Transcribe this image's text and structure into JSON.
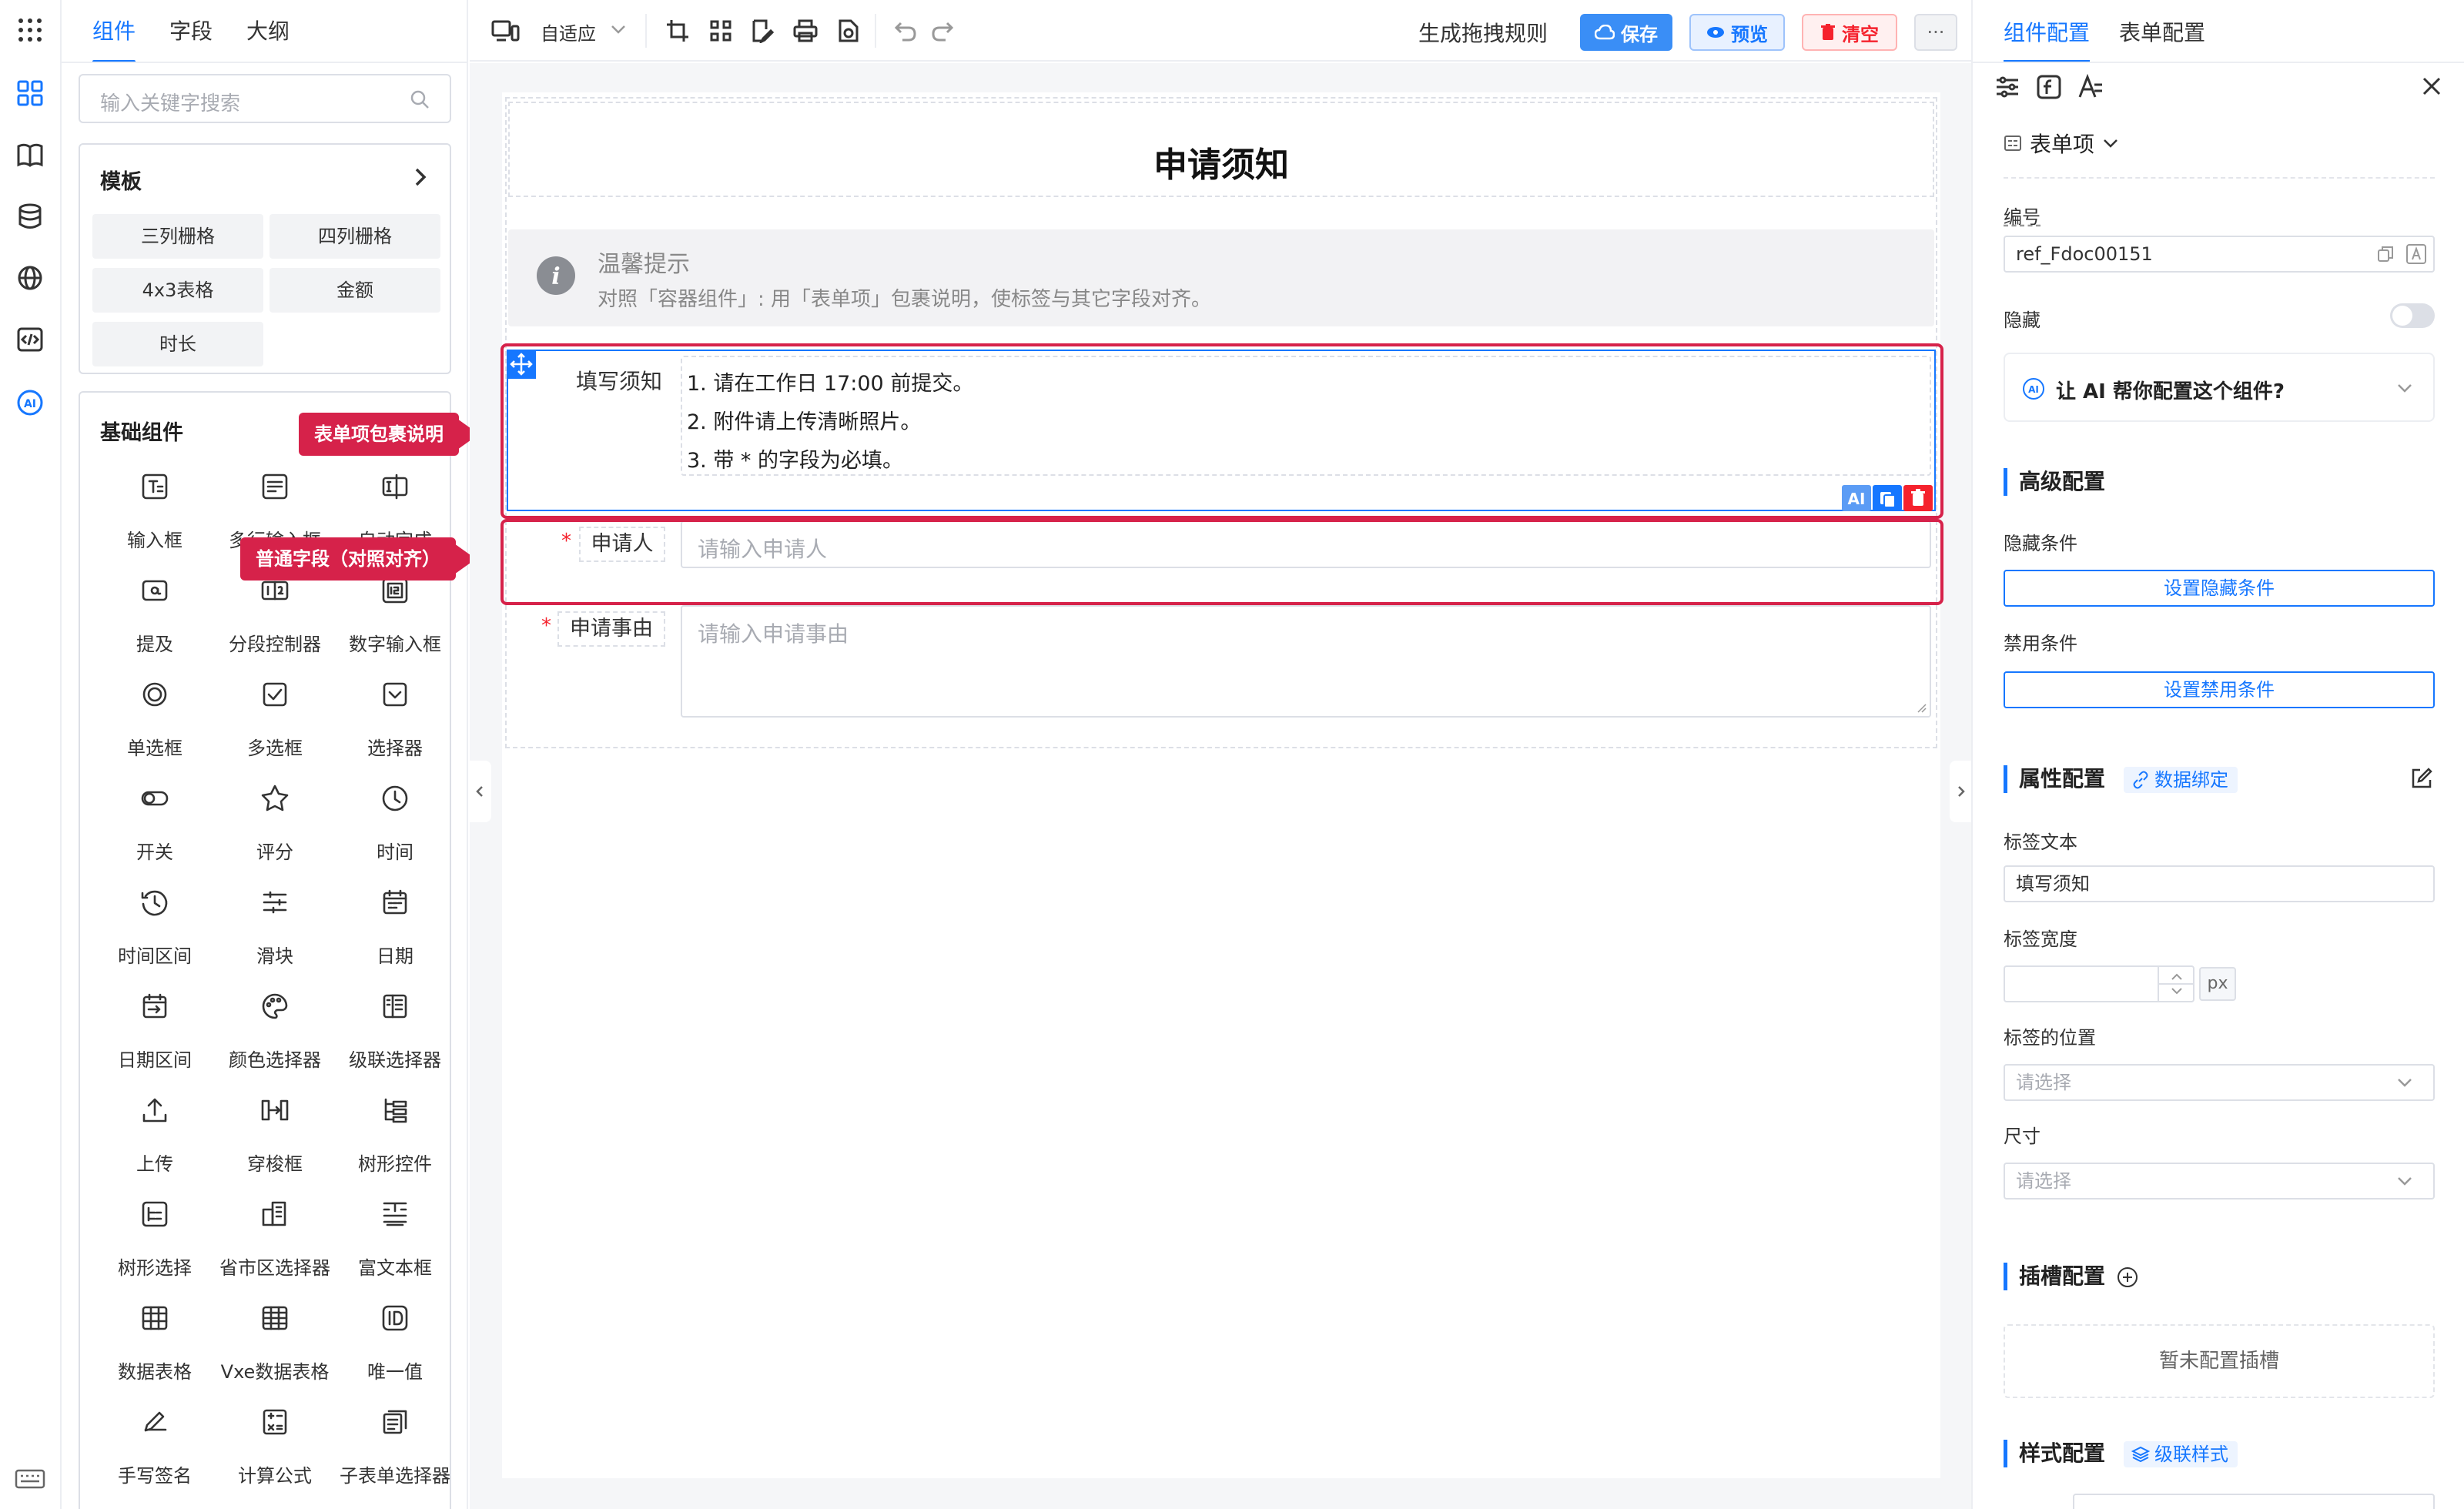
{
  "left_tabs": [
    "组件",
    "字段",
    "大纲"
  ],
  "search": {
    "placeholder": "输入关键字搜索"
  },
  "templates": {
    "title": "模板",
    "items": [
      "三列栅格",
      "四列栅格",
      "4x3表格",
      "金额",
      "时长"
    ]
  },
  "basic": {
    "title": "基础组件",
    "items": [
      {
        "label": "输入框",
        "icon": "input-icon"
      },
      {
        "label": "多行输入框",
        "icon": "textarea-icon"
      },
      {
        "label": "自动完成",
        "icon": "autocomplete-icon"
      },
      {
        "label": "提及",
        "icon": "mention-icon"
      },
      {
        "label": "分段控制器",
        "icon": "segmented-icon"
      },
      {
        "label": "数字输入框",
        "icon": "number-input-icon"
      },
      {
        "label": "单选框",
        "icon": "radio-icon"
      },
      {
        "label": "多选框",
        "icon": "checkbox-icon"
      },
      {
        "label": "选择器",
        "icon": "select-icon"
      },
      {
        "label": "开关",
        "icon": "switch-icon"
      },
      {
        "label": "评分",
        "icon": "star-icon"
      },
      {
        "label": "时间",
        "icon": "clock-icon"
      },
      {
        "label": "时间区间",
        "icon": "time-range-icon"
      },
      {
        "label": "滑块",
        "icon": "slider-icon"
      },
      {
        "label": "日期",
        "icon": "calendar-icon"
      },
      {
        "label": "日期区间",
        "icon": "date-range-icon"
      },
      {
        "label": "颜色选择器",
        "icon": "palette-icon"
      },
      {
        "label": "级联选择器",
        "icon": "cascader-icon"
      },
      {
        "label": "上传",
        "icon": "upload-icon"
      },
      {
        "label": "穿梭框",
        "icon": "transfer-icon"
      },
      {
        "label": "树形控件",
        "icon": "tree-icon"
      },
      {
        "label": "树形选择",
        "icon": "tree-select-icon"
      },
      {
        "label": "省市区选择器",
        "icon": "region-icon"
      },
      {
        "label": "富文本框",
        "icon": "rich-text-icon"
      },
      {
        "label": "数据表格",
        "icon": "table-icon"
      },
      {
        "label": "Vxe数据表格",
        "icon": "vxe-table-icon"
      },
      {
        "label": "唯一值",
        "icon": "id-icon"
      },
      {
        "label": "手写签名",
        "icon": "signature-icon"
      },
      {
        "label": "计算公式",
        "icon": "calculator-icon"
      },
      {
        "label": "子表单选择器",
        "icon": "subform-icon"
      }
    ]
  },
  "callouts": {
    "wrap": "表单项包裹说明",
    "normal": "普通字段（对照对齐）"
  },
  "toolbar": {
    "adaptive": "自适应",
    "gen_rule": "生成拖拽规则",
    "save": "保存",
    "preview": "预览",
    "clear": "清空",
    "more": "···"
  },
  "form": {
    "title": "申请须知",
    "tip_title": "温馨提示",
    "tip_text": "对照「容器组件」: 用「表单项」包裹说明，使标签与其它字段对齐。",
    "notice_label": "填写须知",
    "notice_lines": [
      "1. 请在工作日 17:00 前提交。",
      "2. 附件请上传清晰照片。",
      "3. 带 * 的字段为必填。"
    ],
    "applicant_label": "申请人",
    "applicant_placeholder": "请输入申请人",
    "reason_label": "申请事由",
    "reason_placeholder": "请输入申请事由",
    "required_mark": "*"
  },
  "right": {
    "tabs": [
      "组件配置",
      "表单配置"
    ],
    "type": "表单项",
    "id_label": "编号",
    "id_value": "ref_Fdoc00151",
    "hidden_label": "隐藏",
    "ai_text": "让 AI 帮你配置这个组件?",
    "advanced": "高级配置",
    "hide_cond": "隐藏条件",
    "hide_btn": "设置隐藏条件",
    "disable_cond": "禁用条件",
    "disable_btn": "设置禁用条件",
    "props": "属性配置",
    "bind": "数据绑定",
    "label_text": "标签文本",
    "label_value": "填写须知",
    "label_width": "标签宽度",
    "unit": "px",
    "label_pos": "标签的位置",
    "select_ph": "请选择",
    "size": "尺寸",
    "slot": "插槽配置",
    "slot_empty": "暂未配置插槽",
    "style": "样式配置",
    "cascade_style": "级联样式"
  },
  "colors": {
    "accent": "#1677ff",
    "callout": "#d6224a",
    "clear": "#f5222d"
  }
}
